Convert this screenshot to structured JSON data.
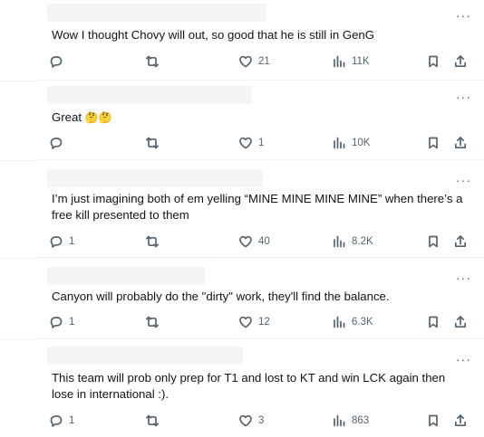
{
  "posts": [
    {
      "text": "Wow I thought Chovy will out, so good that he is still in GenG",
      "replies": "",
      "likes": "21",
      "views": "11K"
    },
    {
      "text": "Great",
      "emoji": "🤔🤔",
      "replies": "",
      "likes": "1",
      "views": "10K"
    },
    {
      "text": "I’m just imagining both of em yelling “MINE MINE MINE MINE” when there’s a free kill presented to them",
      "replies": "1",
      "likes": "40",
      "views": "8.2K"
    },
    {
      "text": "Canyon will probably do the \"dirty\" work, they'll find the balance.",
      "replies": "1",
      "likes": "12",
      "views": "6.3K"
    },
    {
      "text": "This team will prob only prep for T1 and lost to KT and win LCK again then lose in international :).",
      "replies": "1",
      "likes": "3",
      "views": "863"
    }
  ],
  "more_label": "···",
  "icons": {
    "reply": "reply-icon",
    "repost": "repost-icon",
    "like": "heart-icon",
    "views": "views-icon",
    "bookmark": "bookmark-icon",
    "share": "share-icon",
    "more": "more-icon"
  }
}
